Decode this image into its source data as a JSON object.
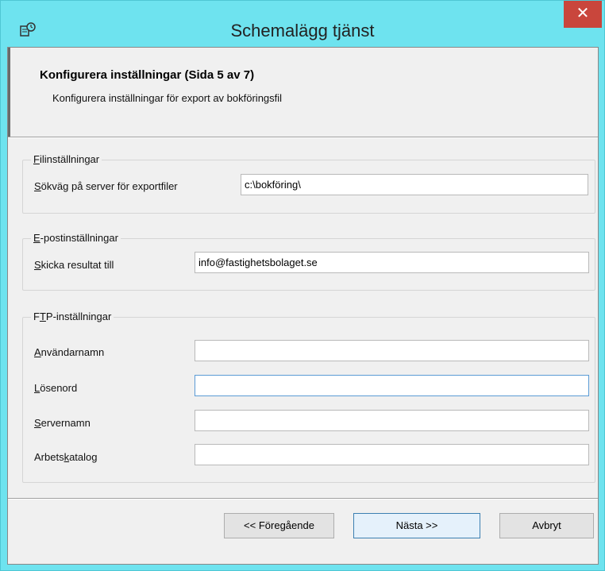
{
  "window": {
    "title": "Schemalägg tjänst",
    "close_label": "✕",
    "icon": "schedule-service-icon"
  },
  "header": {
    "title": "Konfigurera inställningar (Sida 5 av 7)",
    "subtitle": "Konfigurera inställningar för export av bokföringsfil"
  },
  "file_settings": {
    "legend_first": "F",
    "legend_rest": "ilinställningar",
    "export_path_label_first": "S",
    "export_path_label_rest": "ökväg på server för exportfiler",
    "export_path_value": "c:\\bokföring\\"
  },
  "email_settings": {
    "legend_first": "E",
    "legend_rest": "-postinställningar",
    "send_to_label_first": "S",
    "send_to_label_rest": "kicka resultat till",
    "send_to_value": "info@fastighetsbolaget.se"
  },
  "ftp_settings": {
    "legend_pre": "F",
    "legend_u": "T",
    "legend_rest": "P-inställningar",
    "username_label_first": "A",
    "username_label_rest": "nvändarnamn",
    "username_value": "",
    "password_label_first": "L",
    "password_label_rest": "ösenord",
    "password_value": "",
    "server_label_first": "S",
    "server_label_rest": "ervernamn",
    "server_value": "",
    "workdir_label_pre": "Arbets",
    "workdir_label_u": "k",
    "workdir_label_rest": "atalog",
    "workdir_value": ""
  },
  "buttons": {
    "previous": "<< Föregående",
    "next": "Nästa >>",
    "cancel": "Avbryt"
  },
  "colors": {
    "title_bar": "#6ee3ef",
    "close_button": "#c9463c",
    "focus_border": "#5b9bd5"
  }
}
